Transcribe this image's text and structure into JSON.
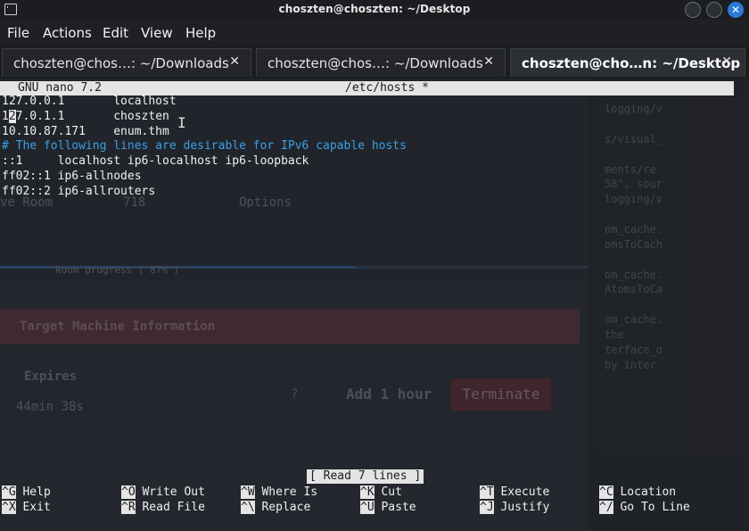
{
  "window": {
    "title": "choszten@choszten: ~/Desktop"
  },
  "menubar": {
    "items": [
      "File",
      "Actions",
      "Edit",
      "View",
      "Help"
    ]
  },
  "tabs": [
    {
      "label": "choszten@chos…: ~/Downloads",
      "close": "✕",
      "active": false
    },
    {
      "label": "choszten@chos…: ~/Downloads",
      "close": "✕",
      "active": false
    },
    {
      "label": "choszten@cho…n: ~/Desktop",
      "close": "✕",
      "active": true
    }
  ],
  "nano": {
    "version": "GNU nano 7.2",
    "filename": "/etc/hosts *",
    "lines": [
      "127.0.0.1       localhost",
      "127.0.1.1       choszten",
      "10.10.87.171    enum.thm",
      "# The following lines are desirable for IPv6 capable hosts",
      "::1     localhost ip6-localhost ip6-loopback",
      "ff02::1 ip6-allnodes",
      "ff02::2 ip6-allrouters"
    ],
    "status": "[ Read 7 lines ]",
    "shortcuts": [
      {
        "key": "^G",
        "label": "Help"
      },
      {
        "key": "^X",
        "label": "Exit"
      },
      {
        "key": "^O",
        "label": "Write Out"
      },
      {
        "key": "^R",
        "label": "Read File"
      },
      {
        "key": "^W",
        "label": "Where Is"
      },
      {
        "key": "^\\",
        "label": "Replace"
      },
      {
        "key": "^K",
        "label": "Cut"
      },
      {
        "key": "^U",
        "label": "Paste"
      },
      {
        "key": "^T",
        "label": "Execute"
      },
      {
        "key": "^J",
        "label": "Justify"
      },
      {
        "key": "^C",
        "label": "Location"
      },
      {
        "key": "^/",
        "label": "Go To Line"
      }
    ]
  },
  "background_app": {
    "room_label": "ve Room",
    "likes": "718",
    "options": "Options",
    "progress": "Room progress ( 87% )",
    "target_title": "Target Machine Information",
    "expires_label": "Expires",
    "expires_value": "44min 38s",
    "question": "?",
    "add_hour": "Add 1 hour",
    "terminate": "Terminate",
    "side_lines": [
      "logging/v",
      "s/visual_",
      "ments/re",
      "58\", sour",
      "logging/v",
      "om_cache.",
      "omsToCach",
      "om_cache.",
      "AtomsToCa",
      "om_cache.",
      "the",
      "terface_o",
      "by inter"
    ]
  },
  "colors": {
    "accent": "#2a7bd8",
    "comment": "#3aa0e8",
    "terminal_bg": "#1f2226"
  }
}
